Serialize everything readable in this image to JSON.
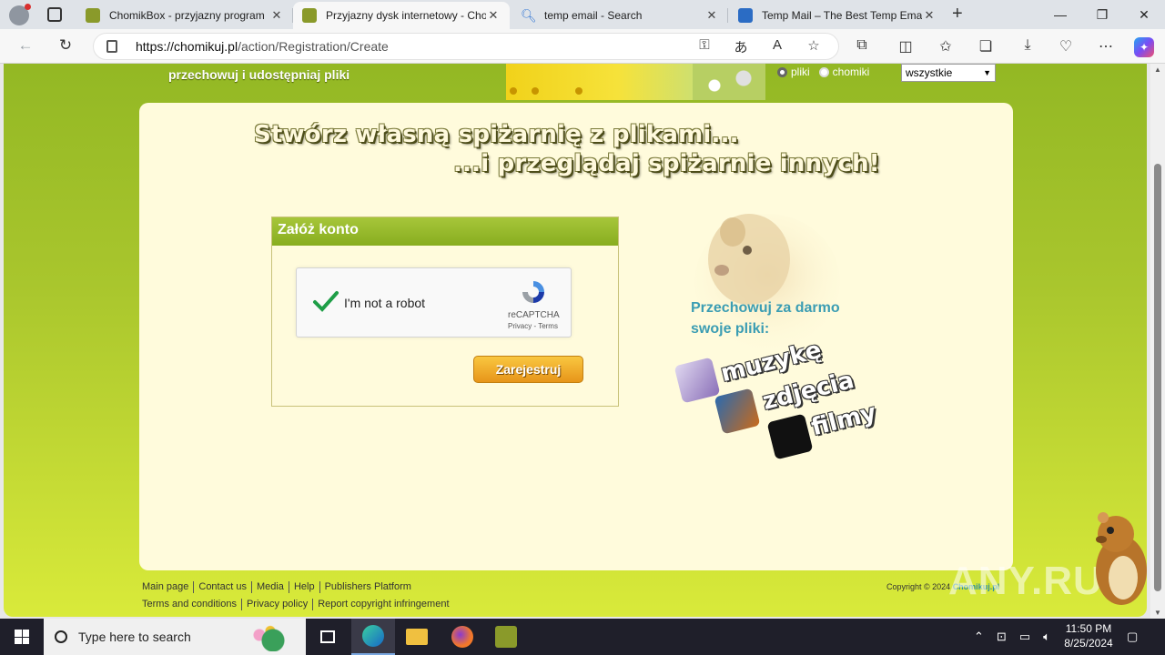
{
  "browser": {
    "tabs": [
      {
        "title": "ChomikBox - przyjazny program",
        "active": false,
        "favicon_color": "#8a9a2a"
      },
      {
        "title": "Przyjazny dysk internetowy - Cho",
        "active": true,
        "favicon_color": "#8a9a2a"
      },
      {
        "title": "temp email - Search",
        "active": false,
        "favicon_color": "#3a7bd5"
      },
      {
        "title": "Temp Mail – The Best Temp Email",
        "active": false,
        "favicon_color": "#2b6cc4"
      }
    ],
    "url_host": "https://chomikuj.pl",
    "url_path": "/action/Registration/Create",
    "window_controls": {
      "minimize": "—",
      "restore": "❐",
      "close": "✕"
    }
  },
  "site": {
    "tagline": "przechowuj i udostępniaj pliki",
    "search_scope": {
      "options": [
        "pliki",
        "chomiki"
      ],
      "selected": "pliki"
    },
    "search_filter": "wszystkie",
    "headline_line1": "Stwórz własną spiżarnię z plikami...",
    "headline_line2": "...i przeglądaj spiżarnie innych!",
    "form": {
      "title": "Załóż konto",
      "captcha_label": "I'm not a robot",
      "captcha_brand": "reCAPTCHA",
      "captcha_links": "Privacy - Terms",
      "submit_label": "Zarejestruj"
    },
    "promo": {
      "line1": "Przechowuj za darmo",
      "line2": "swoje pliki:",
      "items": [
        "muzykę",
        "zdjęcia",
        "filmy"
      ]
    },
    "footer": {
      "row1": [
        "Main page",
        "Contact us",
        "Media",
        "Help",
        "Publishers Platform"
      ],
      "row2": [
        "Terms and conditions",
        "Privacy policy",
        "Report copyright infringement"
      ],
      "copyright_prefix": "Copyright © 2024",
      "copyright_brand": "Chomikuj.pl"
    },
    "watermark": "ANY.RUN"
  },
  "taskbar": {
    "search_placeholder": "Type here to search",
    "time": "11:50 PM",
    "date": "8/25/2024"
  },
  "colors": {
    "site_green": "#93b824",
    "panel_cream": "#fffbdc",
    "promo_teal": "#3b9db3",
    "button_orange": "#e7951a"
  }
}
